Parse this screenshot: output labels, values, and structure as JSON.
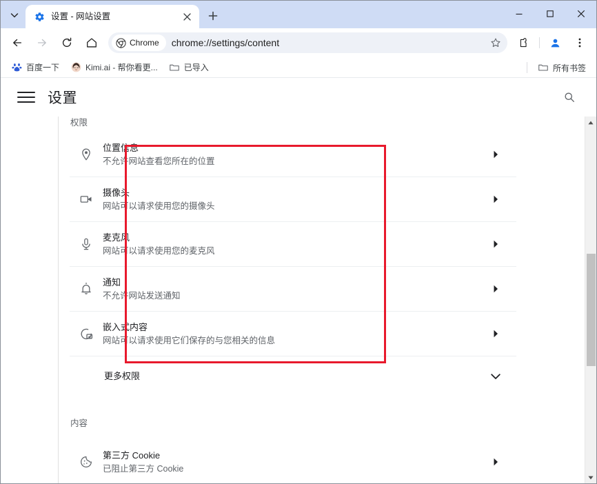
{
  "window": {
    "minimize_label": "─",
    "maximize_label": "□",
    "close_label": "✕"
  },
  "tabstrip": {
    "tab_search_icon": "chevron-down-icon",
    "tabs": [
      {
        "title": "设置 - 网站设置",
        "favicon": "gear-icon",
        "close_label": "✕",
        "active": true
      }
    ],
    "new_tab_label": "+"
  },
  "toolbar": {
    "back_label": "←",
    "forward_label": "→",
    "reload_label": "⟳",
    "home_label": "home-icon",
    "chrome_chip_label": "Chrome",
    "url": "chrome://settings/content",
    "bookmark_star_label": "☆",
    "extensions_label": "extensions-icon",
    "profile_label": "profile-avatar-icon",
    "menu_label": "⋮"
  },
  "bookmarks_bar": {
    "items": [
      {
        "label": "百度一下",
        "icon": "baidu-icon"
      },
      {
        "label": "Kimi.ai - 帮你看更...",
        "icon": "kimi-avatar-icon"
      },
      {
        "label": "已导入",
        "icon": "folder-icon"
      }
    ],
    "all_bookmarks_label": "所有书签",
    "all_bookmarks_icon": "folder-icon"
  },
  "settings": {
    "menu_icon": "hamburger-icon",
    "title": "设置",
    "search_icon": "search-icon",
    "sections": [
      {
        "label": "权限",
        "rows": [
          {
            "icon": "location-pin-icon",
            "title": "位置信息",
            "subtitle": "不允许网站查看您所在的位置",
            "arrow": "▸"
          },
          {
            "icon": "camera-icon",
            "title": "摄像头",
            "subtitle": "网站可以请求使用您的摄像头",
            "arrow": "▸"
          },
          {
            "icon": "microphone-icon",
            "title": "麦克风",
            "subtitle": "网站可以请求使用您的麦克风",
            "arrow": "▸"
          },
          {
            "icon": "bell-icon",
            "title": "通知",
            "subtitle": "不允许网站发送通知",
            "arrow": "▸"
          },
          {
            "icon": "embedded-content-icon",
            "title": "嵌入式内容",
            "subtitle": "网站可以请求使用它们保存的与您相关的信息",
            "arrow": "▸"
          }
        ],
        "expander": {
          "title": "更多权限",
          "arrow": "⌄",
          "icon": "chevron-down-icon"
        }
      },
      {
        "label": "内容",
        "rows": [
          {
            "icon": "cookie-icon",
            "title": "第三方 Cookie",
            "subtitle": "已阻止第三方 Cookie",
            "arrow": "▸"
          }
        ]
      }
    ]
  },
  "annotation": {
    "highlight_color": "#e8192c",
    "target": "permissions-group"
  },
  "scrollbar": {
    "up_arrow": "▲",
    "down_arrow": "▼"
  }
}
